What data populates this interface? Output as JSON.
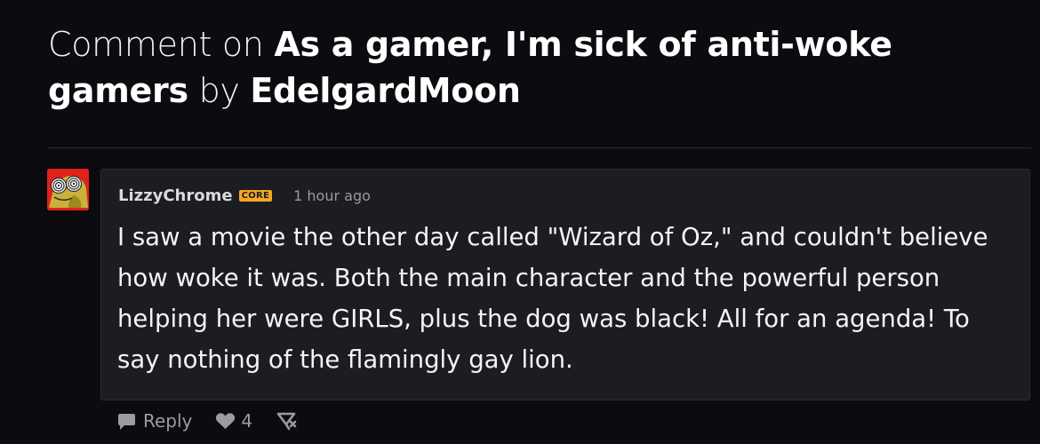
{
  "header": {
    "prefix": "Comment on",
    "post_title": "As a gamer, I'm sick of anti-woke gamers",
    "by_label": "by",
    "author": "EdelgardMoon"
  },
  "comment": {
    "avatar_icon": "hypno-eyes-avatar",
    "username": "LizzyChrome",
    "badge": "CORE",
    "badge_color": "#f5a623",
    "time": "1 hour ago",
    "text": "I saw a movie the other day called \"Wizard of Oz,\" and couldn't believe how woke it was. Both the main character and the powerful person helping her were GIRLS, plus the dog was black! All for an agenda! To say nothing of the flamingly gay lion."
  },
  "actions": {
    "reply_icon": "speech-bubble-icon",
    "reply_label": "Reply",
    "like_icon": "heart-icon",
    "like_count": "4",
    "share_icon": "share-icon"
  }
}
